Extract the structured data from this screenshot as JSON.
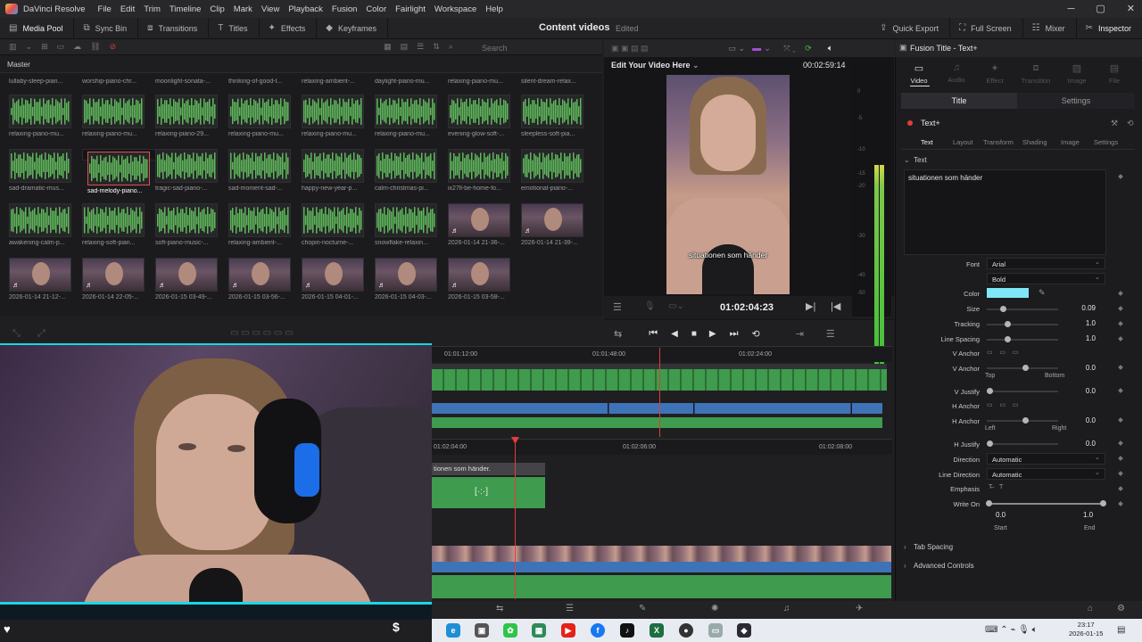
{
  "menubar": {
    "app": "DaVinci Resolve",
    "items": [
      "File",
      "Edit",
      "Trim",
      "Timeline",
      "Clip",
      "Mark",
      "View",
      "Playback",
      "Fusion",
      "Color",
      "Fairlight",
      "Workspace",
      "Help"
    ]
  },
  "toolbar": {
    "left": [
      {
        "icon": "media-pool-icon",
        "label": "Media Pool"
      },
      {
        "icon": "sync-bin-icon",
        "label": "Sync Bin"
      },
      {
        "icon": "transitions-icon",
        "label": "Transitions"
      },
      {
        "icon": "titles-icon",
        "label": "Titles"
      },
      {
        "icon": "effects-icon",
        "label": "Effects"
      },
      {
        "icon": "keyframes-icon",
        "label": "Keyframes"
      }
    ],
    "project_title": "Content videos",
    "project_status": "Edited",
    "right": [
      {
        "icon": "quick-export-icon",
        "label": "Quick Export"
      },
      {
        "icon": "full-screen-icon",
        "label": "Full Screen"
      },
      {
        "icon": "mixer-icon",
        "label": "Mixer"
      },
      {
        "icon": "inspector-icon",
        "label": "Inspector"
      }
    ]
  },
  "media_pool": {
    "search_placeholder": "Search",
    "bin": "Master",
    "top_row_labels": [
      "lullaby-sleep-pian...",
      "worship-piano-chr...",
      "moonlight-sonata-...",
      "thinking-of-good-t...",
      "relaxing-ambient-...",
      "daylight-piano-mu...",
      "relaxing-piano-mu...",
      "silent-dream-relax..."
    ],
    "rows": [
      [
        {
          "label": "relaxing-piano-mu...",
          "kind": "audio"
        },
        {
          "label": "relaxing-piano-mu...",
          "kind": "audio"
        },
        {
          "label": "relaxing-piano-29...",
          "kind": "audio"
        },
        {
          "label": "relaxing-piano-mu...",
          "kind": "audio"
        },
        {
          "label": "relaxing-piano-mu...",
          "kind": "audio"
        },
        {
          "label": "relaxing-piano-mu...",
          "kind": "audio"
        },
        {
          "label": "evening-glow-soft-...",
          "kind": "audio"
        },
        {
          "label": "sleepless-soft-pia...",
          "kind": "audio"
        }
      ],
      [
        {
          "label": "sad-dramatic-mus...",
          "kind": "audio"
        },
        {
          "label": "sad-melody-piano...",
          "kind": "audio",
          "selected": true
        },
        {
          "label": "tragic-sad-piano-...",
          "kind": "audio"
        },
        {
          "label": "sad-moment-sad-...",
          "kind": "audio"
        },
        {
          "label": "happy-new-year-p...",
          "kind": "audio"
        },
        {
          "label": "calm-christmas-pi...",
          "kind": "audio"
        },
        {
          "label": "ix27ll-be-home-fo...",
          "kind": "audio"
        },
        {
          "label": "emotional-piano-...",
          "kind": "audio"
        }
      ],
      [
        {
          "label": "awakening-calm-p...",
          "kind": "audio"
        },
        {
          "label": "relaxing-soft-pian...",
          "kind": "audio"
        },
        {
          "label": "soft-piano-music-...",
          "kind": "audio"
        },
        {
          "label": "relaxing-ambient-...",
          "kind": "audio"
        },
        {
          "label": "chopin-nocturne-...",
          "kind": "audio"
        },
        {
          "label": "snowflake-relaxin...",
          "kind": "audio"
        },
        {
          "label": "2026-01-14 21-36-...",
          "kind": "video"
        },
        {
          "label": "2026-01-14 21-39-...",
          "kind": "video"
        }
      ],
      [
        {
          "label": "2026-01-14 21-12-...",
          "kind": "video"
        },
        {
          "label": "2026-01-14 22-05-...",
          "kind": "video"
        },
        {
          "label": "2026-01-15 03-49-...",
          "kind": "video"
        },
        {
          "label": "2026-01-15 03-56-...",
          "kind": "video"
        },
        {
          "label": "2026-01-15 04-01-...",
          "kind": "video"
        },
        {
          "label": "2026-01-15 04-03-...",
          "kind": "video"
        },
        {
          "label": "2026-01-15 03-58-...",
          "kind": "video"
        }
      ]
    ]
  },
  "viewer": {
    "title": "Edit Your Video Here",
    "duration": "00:02:59:14",
    "subtitle": "situationen som händer",
    "current_tc": "01:02:04:23",
    "vu_ticks": [
      "0",
      "-5",
      "-10",
      "-15",
      "-20",
      "-30",
      "-40",
      "-50"
    ]
  },
  "timeline": {
    "ruler1": [
      "01:01:12:00",
      "01:01:48:00",
      "01:02:24:00"
    ],
    "ruler2": [
      "01:02:04:00",
      "01:02:06:00",
      "01:02:08:00"
    ],
    "subtitle_clip": "tionen som händer.",
    "title_clip_glyph": "[·:·]"
  },
  "inspector": {
    "title": "Fusion Title - Text+",
    "tabs": [
      {
        "icon": "video-icon",
        "label": "Video",
        "active": true
      },
      {
        "icon": "audio-icon",
        "label": "Audio"
      },
      {
        "icon": "effect-icon",
        "label": "Effect"
      },
      {
        "icon": "transition-icon",
        "label": "Transition"
      },
      {
        "icon": "image-icon",
        "label": "Image"
      },
      {
        "icon": "file-icon",
        "label": "File"
      }
    ],
    "subtabs": [
      "Title",
      "Settings"
    ],
    "node": "Text+",
    "sections": [
      "Text",
      "Layout",
      "Transform",
      "Shading",
      "Image",
      "Settings"
    ],
    "text_header": "Text",
    "text_value": "situationen som händer",
    "font_label": "Font",
    "font": "Arial",
    "style": "Bold",
    "color_label": "Color",
    "color": "#7fe7f5",
    "size_label": "Size",
    "size": "0.09",
    "size_frac": 0.09,
    "tracking_label": "Tracking",
    "tracking": "1.0",
    "line_spacing_label": "Line Spacing",
    "line_spacing": "1.0",
    "v_anchor_label": "V Anchor",
    "v_anchor": "0.0",
    "v_top": "Top",
    "v_bottom": "Bottom",
    "v_justify_label": "V Justify",
    "v_justify": "0.0",
    "h_anchor_label": "H Anchor",
    "h_anchor": "0.0",
    "h_left": "Left",
    "h_right": "Right",
    "h_justify_label": "H Justify",
    "h_justify": "0.0",
    "direction_label": "Direction",
    "direction": "Automatic",
    "line_direction_label": "Line Direction",
    "line_direction": "Automatic",
    "emphasis_label": "Emphasis",
    "write_on_label": "Write On",
    "write_start": "0.0",
    "write_end": "1.0",
    "start_label": "Start",
    "end_label": "End",
    "tab_spacing": "Tab Spacing",
    "advanced": "Advanced Controls"
  },
  "taskbar": {
    "time": "23:17",
    "date": "2026-01-15"
  }
}
